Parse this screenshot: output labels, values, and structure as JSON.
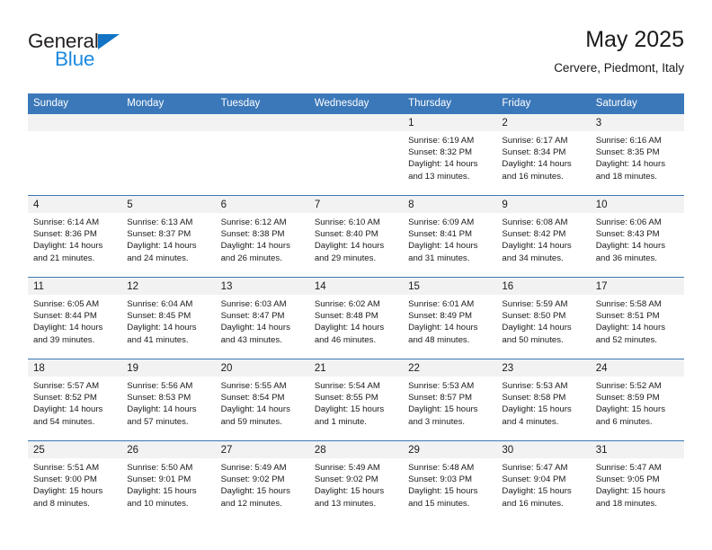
{
  "logo": {
    "word_one": "General",
    "word_two": "Blue",
    "triangle_icon": "triangle-icon",
    "brand_dark": "#231f20",
    "brand_blue": "#1b8ae0"
  },
  "header": {
    "title": "May 2025",
    "subtitle": "Cervere, Piedmont, Italy"
  },
  "colors": {
    "header_blue": "#3b78b9",
    "date_strip_gray": "#f2f2f2",
    "text": "#1a1a1a"
  },
  "weekday_headers": [
    "Sunday",
    "Monday",
    "Tuesday",
    "Wednesday",
    "Thursday",
    "Friday",
    "Saturday"
  ],
  "weeks": [
    [
      {
        "date": "",
        "sunrise": "",
        "sunset": "",
        "daylight_line1": "",
        "daylight_line2": "",
        "empty": true
      },
      {
        "date": "",
        "sunrise": "",
        "sunset": "",
        "daylight_line1": "",
        "daylight_line2": "",
        "empty": true
      },
      {
        "date": "",
        "sunrise": "",
        "sunset": "",
        "daylight_line1": "",
        "daylight_line2": "",
        "empty": true
      },
      {
        "date": "",
        "sunrise": "",
        "sunset": "",
        "daylight_line1": "",
        "daylight_line2": "",
        "empty": true
      },
      {
        "date": "1",
        "sunrise": "Sunrise: 6:19 AM",
        "sunset": "Sunset: 8:32 PM",
        "daylight_line1": "Daylight: 14 hours",
        "daylight_line2": "and 13 minutes.",
        "empty": false
      },
      {
        "date": "2",
        "sunrise": "Sunrise: 6:17 AM",
        "sunset": "Sunset: 8:34 PM",
        "daylight_line1": "Daylight: 14 hours",
        "daylight_line2": "and 16 minutes.",
        "empty": false
      },
      {
        "date": "3",
        "sunrise": "Sunrise: 6:16 AM",
        "sunset": "Sunset: 8:35 PM",
        "daylight_line1": "Daylight: 14 hours",
        "daylight_line2": "and 18 minutes.",
        "empty": false
      }
    ],
    [
      {
        "date": "4",
        "sunrise": "Sunrise: 6:14 AM",
        "sunset": "Sunset: 8:36 PM",
        "daylight_line1": "Daylight: 14 hours",
        "daylight_line2": "and 21 minutes.",
        "empty": false
      },
      {
        "date": "5",
        "sunrise": "Sunrise: 6:13 AM",
        "sunset": "Sunset: 8:37 PM",
        "daylight_line1": "Daylight: 14 hours",
        "daylight_line2": "and 24 minutes.",
        "empty": false
      },
      {
        "date": "6",
        "sunrise": "Sunrise: 6:12 AM",
        "sunset": "Sunset: 8:38 PM",
        "daylight_line1": "Daylight: 14 hours",
        "daylight_line2": "and 26 minutes.",
        "empty": false
      },
      {
        "date": "7",
        "sunrise": "Sunrise: 6:10 AM",
        "sunset": "Sunset: 8:40 PM",
        "daylight_line1": "Daylight: 14 hours",
        "daylight_line2": "and 29 minutes.",
        "empty": false
      },
      {
        "date": "8",
        "sunrise": "Sunrise: 6:09 AM",
        "sunset": "Sunset: 8:41 PM",
        "daylight_line1": "Daylight: 14 hours",
        "daylight_line2": "and 31 minutes.",
        "empty": false
      },
      {
        "date": "9",
        "sunrise": "Sunrise: 6:08 AM",
        "sunset": "Sunset: 8:42 PM",
        "daylight_line1": "Daylight: 14 hours",
        "daylight_line2": "and 34 minutes.",
        "empty": false
      },
      {
        "date": "10",
        "sunrise": "Sunrise: 6:06 AM",
        "sunset": "Sunset: 8:43 PM",
        "daylight_line1": "Daylight: 14 hours",
        "daylight_line2": "and 36 minutes.",
        "empty": false
      }
    ],
    [
      {
        "date": "11",
        "sunrise": "Sunrise: 6:05 AM",
        "sunset": "Sunset: 8:44 PM",
        "daylight_line1": "Daylight: 14 hours",
        "daylight_line2": "and 39 minutes.",
        "empty": false
      },
      {
        "date": "12",
        "sunrise": "Sunrise: 6:04 AM",
        "sunset": "Sunset: 8:45 PM",
        "daylight_line1": "Daylight: 14 hours",
        "daylight_line2": "and 41 minutes.",
        "empty": false
      },
      {
        "date": "13",
        "sunrise": "Sunrise: 6:03 AM",
        "sunset": "Sunset: 8:47 PM",
        "daylight_line1": "Daylight: 14 hours",
        "daylight_line2": "and 43 minutes.",
        "empty": false
      },
      {
        "date": "14",
        "sunrise": "Sunrise: 6:02 AM",
        "sunset": "Sunset: 8:48 PM",
        "daylight_line1": "Daylight: 14 hours",
        "daylight_line2": "and 46 minutes.",
        "empty": false
      },
      {
        "date": "15",
        "sunrise": "Sunrise: 6:01 AM",
        "sunset": "Sunset: 8:49 PM",
        "daylight_line1": "Daylight: 14 hours",
        "daylight_line2": "and 48 minutes.",
        "empty": false
      },
      {
        "date": "16",
        "sunrise": "Sunrise: 5:59 AM",
        "sunset": "Sunset: 8:50 PM",
        "daylight_line1": "Daylight: 14 hours",
        "daylight_line2": "and 50 minutes.",
        "empty": false
      },
      {
        "date": "17",
        "sunrise": "Sunrise: 5:58 AM",
        "sunset": "Sunset: 8:51 PM",
        "daylight_line1": "Daylight: 14 hours",
        "daylight_line2": "and 52 minutes.",
        "empty": false
      }
    ],
    [
      {
        "date": "18",
        "sunrise": "Sunrise: 5:57 AM",
        "sunset": "Sunset: 8:52 PM",
        "daylight_line1": "Daylight: 14 hours",
        "daylight_line2": "and 54 minutes.",
        "empty": false
      },
      {
        "date": "19",
        "sunrise": "Sunrise: 5:56 AM",
        "sunset": "Sunset: 8:53 PM",
        "daylight_line1": "Daylight: 14 hours",
        "daylight_line2": "and 57 minutes.",
        "empty": false
      },
      {
        "date": "20",
        "sunrise": "Sunrise: 5:55 AM",
        "sunset": "Sunset: 8:54 PM",
        "daylight_line1": "Daylight: 14 hours",
        "daylight_line2": "and 59 minutes.",
        "empty": false
      },
      {
        "date": "21",
        "sunrise": "Sunrise: 5:54 AM",
        "sunset": "Sunset: 8:55 PM",
        "daylight_line1": "Daylight: 15 hours",
        "daylight_line2": "and 1 minute.",
        "empty": false
      },
      {
        "date": "22",
        "sunrise": "Sunrise: 5:53 AM",
        "sunset": "Sunset: 8:57 PM",
        "daylight_line1": "Daylight: 15 hours",
        "daylight_line2": "and 3 minutes.",
        "empty": false
      },
      {
        "date": "23",
        "sunrise": "Sunrise: 5:53 AM",
        "sunset": "Sunset: 8:58 PM",
        "daylight_line1": "Daylight: 15 hours",
        "daylight_line2": "and 4 minutes.",
        "empty": false
      },
      {
        "date": "24",
        "sunrise": "Sunrise: 5:52 AM",
        "sunset": "Sunset: 8:59 PM",
        "daylight_line1": "Daylight: 15 hours",
        "daylight_line2": "and 6 minutes.",
        "empty": false
      }
    ],
    [
      {
        "date": "25",
        "sunrise": "Sunrise: 5:51 AM",
        "sunset": "Sunset: 9:00 PM",
        "daylight_line1": "Daylight: 15 hours",
        "daylight_line2": "and 8 minutes.",
        "empty": false
      },
      {
        "date": "26",
        "sunrise": "Sunrise: 5:50 AM",
        "sunset": "Sunset: 9:01 PM",
        "daylight_line1": "Daylight: 15 hours",
        "daylight_line2": "and 10 minutes.",
        "empty": false
      },
      {
        "date": "27",
        "sunrise": "Sunrise: 5:49 AM",
        "sunset": "Sunset: 9:02 PM",
        "daylight_line1": "Daylight: 15 hours",
        "daylight_line2": "and 12 minutes.",
        "empty": false
      },
      {
        "date": "28",
        "sunrise": "Sunrise: 5:49 AM",
        "sunset": "Sunset: 9:02 PM",
        "daylight_line1": "Daylight: 15 hours",
        "daylight_line2": "and 13 minutes.",
        "empty": false
      },
      {
        "date": "29",
        "sunrise": "Sunrise: 5:48 AM",
        "sunset": "Sunset: 9:03 PM",
        "daylight_line1": "Daylight: 15 hours",
        "daylight_line2": "and 15 minutes.",
        "empty": false
      },
      {
        "date": "30",
        "sunrise": "Sunrise: 5:47 AM",
        "sunset": "Sunset: 9:04 PM",
        "daylight_line1": "Daylight: 15 hours",
        "daylight_line2": "and 16 minutes.",
        "empty": false
      },
      {
        "date": "31",
        "sunrise": "Sunrise: 5:47 AM",
        "sunset": "Sunset: 9:05 PM",
        "daylight_line1": "Daylight: 15 hours",
        "daylight_line2": "and 18 minutes.",
        "empty": false
      }
    ]
  ]
}
